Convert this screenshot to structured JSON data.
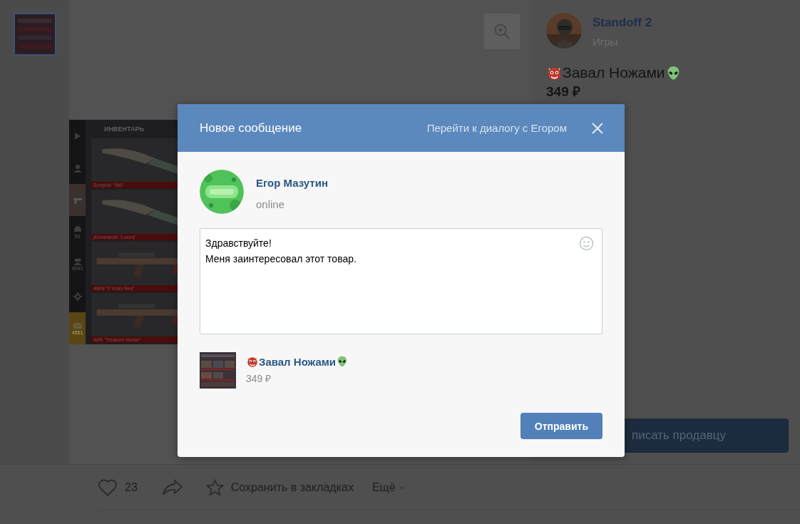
{
  "thumbnails": [
    {
      "selected": true
    }
  ],
  "product_image": {
    "header": "ИНВЕНТАРЬ",
    "side_items": [
      {
        "kind": "play",
        "selected": false
      },
      {
        "kind": "user",
        "selected": false
      },
      {
        "kind": "pistol",
        "selected": true
      },
      {
        "kind": "helmet",
        "count": "50",
        "selected": false
      },
      {
        "kind": "group",
        "count": "9092",
        "selected": false
      },
      {
        "kind": "gear",
        "selected": false
      },
      {
        "kind": "mail",
        "count": "4551",
        "selected": false
      }
    ],
    "items": [
      {
        "kind": "knife",
        "name": "Scorpion \"Veil\""
      },
      {
        "kind": "knife",
        "name": "jKommando \"Luxury\""
      },
      {
        "kind": "rifle",
        "name": "AWM \"2 Years Red\""
      },
      {
        "kind": "rifle",
        "name": "AKR \"Treasure Hunter\""
      }
    ]
  },
  "seller": {
    "name": "Standoff 2",
    "category": "Игры"
  },
  "product": {
    "title": "Завал Ножами",
    "price": "349 ₽"
  },
  "contact_button": "писать продавцу",
  "actions": {
    "likes": "23",
    "bookmark": "Сохранить в закладках",
    "more": "Ещё"
  },
  "dialog": {
    "title": "Новое сообщение",
    "link": "Перейти к диалогу с Егором",
    "recipient": {
      "name": "Егор Мазутин",
      "status": "online"
    },
    "message": {
      "lines": [
        "Здравствуйте!",
        "Меня заинтересовал этот товар."
      ]
    },
    "attachment": {
      "title": "Завал Ножами",
      "price": "349 ₽"
    },
    "send_button": "Отправить"
  }
}
